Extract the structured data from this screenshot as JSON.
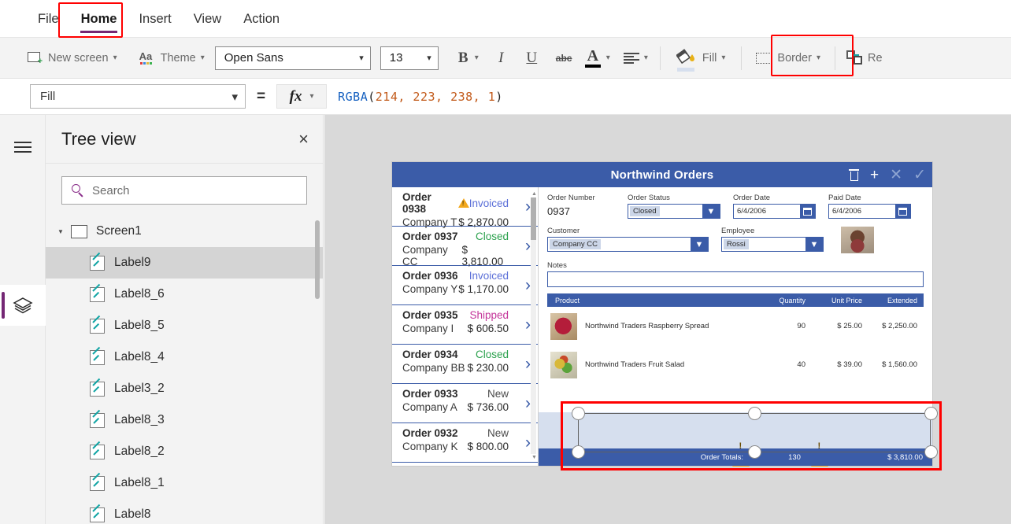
{
  "menu": {
    "items": [
      {
        "label": "File",
        "active": false
      },
      {
        "label": "Home",
        "active": true
      },
      {
        "label": "Insert",
        "active": false
      },
      {
        "label": "View",
        "active": false
      },
      {
        "label": "Action",
        "active": false
      }
    ],
    "highlight_color": "#ff0000",
    "accent_color": "#742774"
  },
  "ribbon": {
    "new_screen": "New screen",
    "theme": "Theme",
    "font_name": "Open Sans",
    "font_size": "13",
    "bold": "B",
    "italic": "I",
    "underline": "U",
    "strikethrough": "abc",
    "font_color": "A",
    "align": "align",
    "fill": "Fill",
    "fill_swatch": "#d6dfee",
    "border": "Border",
    "reorder": "Re"
  },
  "formula_bar": {
    "property": "Fill",
    "equals": "=",
    "fx": "fx",
    "formula_fn": "RGBA",
    "formula_open": "(",
    "formula_args": "214, 223, 238, 1",
    "formula_close": ")",
    "arg_r": "214,",
    "arg_g": "223,",
    "arg_b": "238,",
    "arg_a": "1"
  },
  "tree_panel": {
    "title": "Tree view",
    "close": "×",
    "search_placeholder": "Search",
    "root": {
      "label": "Screen1",
      "expanded": true
    },
    "items": [
      {
        "label": "Label9",
        "selected": true
      },
      {
        "label": "Label8_6",
        "selected": false
      },
      {
        "label": "Label8_5",
        "selected": false
      },
      {
        "label": "Label8_4",
        "selected": false
      },
      {
        "label": "Label3_2",
        "selected": false
      },
      {
        "label": "Label8_3",
        "selected": false
      },
      {
        "label": "Label8_2",
        "selected": false
      },
      {
        "label": "Label8_1",
        "selected": false
      },
      {
        "label": "Label8",
        "selected": false
      }
    ]
  },
  "app": {
    "title": "Northwind Orders",
    "header_color": "#3b5ca8",
    "gallery": [
      {
        "order": "Order 0938",
        "company": "Company T",
        "status": "Invoiced",
        "status_class": "st-invoiced",
        "amount": "$ 2,870.00",
        "warning": true
      },
      {
        "order": "Order 0937",
        "company": "Company CC",
        "status": "Closed",
        "status_class": "st-closed",
        "amount": "$ 3,810.00",
        "warning": false
      },
      {
        "order": "Order 0936",
        "company": "Company Y",
        "status": "Invoiced",
        "status_class": "st-invoiced",
        "amount": "$ 1,170.00",
        "warning": false
      },
      {
        "order": "Order 0935",
        "company": "Company I",
        "status": "Shipped",
        "status_class": "st-shipped",
        "amount": "$ 606.50",
        "warning": false
      },
      {
        "order": "Order 0934",
        "company": "Company BB",
        "status": "Closed",
        "status_class": "st-closed",
        "amount": "$ 230.00",
        "warning": false
      },
      {
        "order": "Order 0933",
        "company": "Company A",
        "status": "New",
        "status_class": "st-new",
        "amount": "$ 736.00",
        "warning": false
      },
      {
        "order": "Order 0932",
        "company": "Company K",
        "status": "New",
        "status_class": "st-new",
        "amount": "$ 800.00",
        "warning": false
      }
    ],
    "form": {
      "order_number_label": "Order Number",
      "order_number_value": "0937",
      "order_status_label": "Order Status",
      "order_status_value": "Closed",
      "order_date_label": "Order Date",
      "order_date_value": "6/4/2006",
      "paid_date_label": "Paid Date",
      "paid_date_value": "6/4/2006",
      "customer_label": "Customer",
      "customer_value": "Company CC",
      "employee_label": "Employee",
      "employee_value": "Rossi",
      "notes_label": "Notes",
      "notes_value": ""
    },
    "products_table": {
      "headers": [
        "Product",
        "Quantity",
        "Unit Price",
        "Extended"
      ],
      "rows": [
        {
          "product": "Northwind Traders Raspberry Spread",
          "quantity": "90",
          "unit_price": "$ 25.00",
          "extended": "$ 2,250.00",
          "img": "raspberry"
        },
        {
          "product": "Northwind Traders Fruit Salad",
          "quantity": "40",
          "unit_price": "$ 39.00",
          "extended": "$ 1,560.00",
          "img": "fruit"
        }
      ]
    },
    "totals": {
      "label": "Order Totals:",
      "quantity": "130",
      "amount": "$ 3,810.00",
      "fill_color": "#d6dfee"
    }
  }
}
